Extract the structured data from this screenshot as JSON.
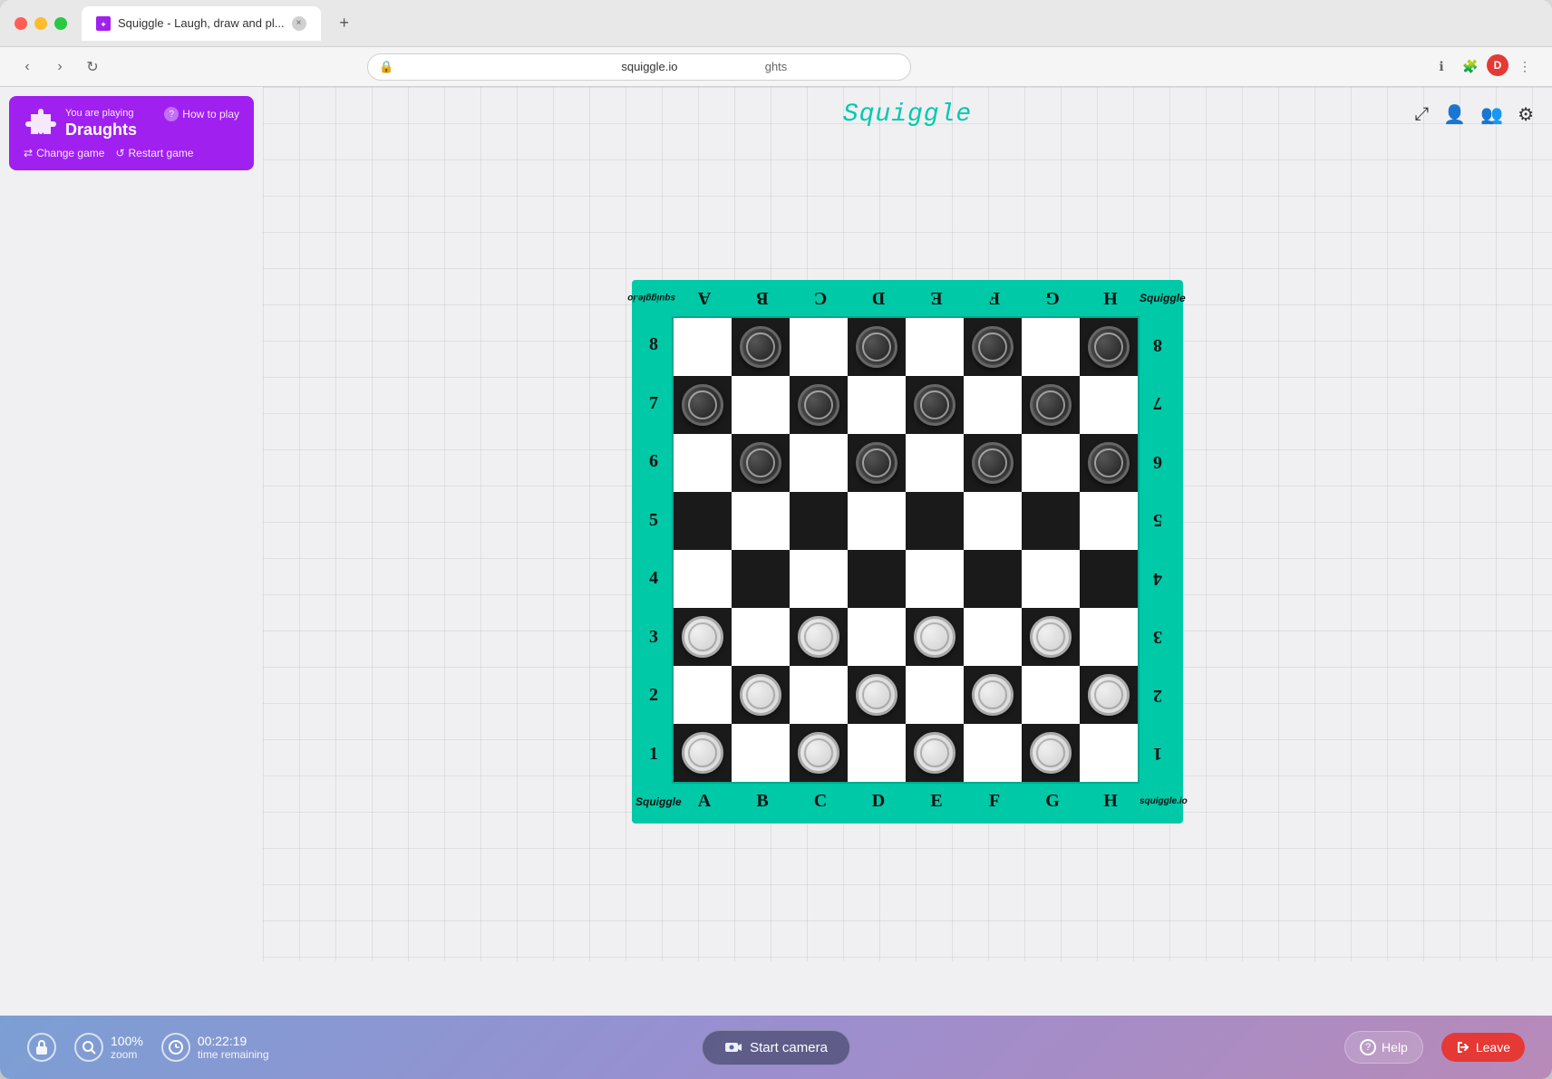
{
  "browser": {
    "tab_title": "Squiggle - Laugh, draw and pl...",
    "url": "squiggle.io",
    "address_bar_text": "ghts",
    "new_tab_label": "+",
    "user_initial": "D"
  },
  "header": {
    "app_title": "Squiggle",
    "icons": {
      "compress": "⤡",
      "add_person": "👤+",
      "group": "👥",
      "settings": "⚙"
    }
  },
  "left_panel": {
    "playing_label": "You are playing",
    "game_name": "Draughts",
    "how_to_label": "How to play",
    "change_label": "Change game",
    "restart_label": "Restart game"
  },
  "board": {
    "col_labels": [
      "A",
      "B",
      "C",
      "D",
      "E",
      "F",
      "G",
      "H"
    ],
    "col_labels_flipped": [
      "A",
      "B",
      "C",
      "D",
      "E",
      "F",
      "G",
      "H"
    ],
    "row_labels_left": [
      "8",
      "7",
      "6",
      "5",
      "4",
      "3",
      "2",
      "1"
    ],
    "row_labels_right": [
      "8",
      "7",
      "6",
      "5",
      "4",
      "3",
      "2",
      "1"
    ],
    "corner_text_tl": "squiggle.io",
    "corner_text_tr": "Squiggle",
    "corner_text_bl": "Squiggle",
    "corner_text_br": "squiggle.io"
  },
  "toolbar": {
    "lock_icon": "🔒",
    "zoom_value": "100%",
    "zoom_label": "zoom",
    "clock_icon": "🕐",
    "time_value": "00:22:19",
    "time_label": "time remaining",
    "start_camera_label": "Start camera",
    "camera_icon": "📷",
    "help_label": "Help",
    "leave_label": "Leave"
  },
  "pieces": {
    "dark_positions": [
      [
        0,
        1
      ],
      [
        0,
        3
      ],
      [
        0,
        5
      ],
      [
        0,
        7
      ],
      [
        1,
        0
      ],
      [
        1,
        2
      ],
      [
        1,
        4
      ],
      [
        1,
        6
      ],
      [
        2,
        1
      ],
      [
        2,
        3
      ],
      [
        2,
        5
      ],
      [
        2,
        7
      ]
    ],
    "light_positions": [
      [
        5,
        0
      ],
      [
        5,
        2
      ],
      [
        5,
        4
      ],
      [
        5,
        6
      ],
      [
        6,
        1
      ],
      [
        6,
        3
      ],
      [
        6,
        5
      ],
      [
        6,
        7
      ],
      [
        7,
        0
      ],
      [
        7,
        2
      ],
      [
        7,
        4
      ],
      [
        7,
        6
      ]
    ]
  }
}
